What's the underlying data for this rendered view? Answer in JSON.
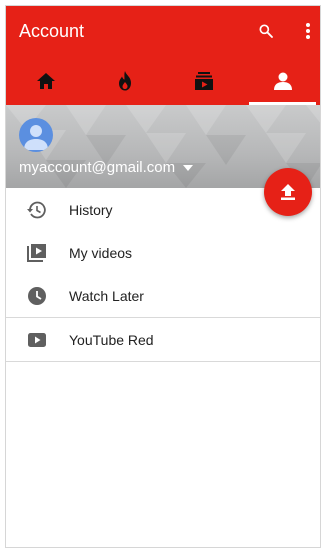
{
  "appbar": {
    "title": "Account",
    "actions": [
      {
        "icon": "search-icon"
      },
      {
        "icon": "more-vert-icon"
      }
    ]
  },
  "tabs": [
    {
      "icon": "home-icon",
      "active": false
    },
    {
      "icon": "trending-icon",
      "active": false
    },
    {
      "icon": "subscriptions-icon",
      "active": false
    },
    {
      "icon": "account-icon",
      "active": true
    }
  ],
  "account": {
    "email": "myaccount@gmail.com",
    "avatar": "avatar-icon"
  },
  "fab": {
    "icon": "upload-icon"
  },
  "menu": {
    "group1": [
      {
        "label": "History",
        "icon": "history-icon"
      },
      {
        "label": "My videos",
        "icon": "my-videos-icon"
      },
      {
        "label": "Watch Later",
        "icon": "watch-later-icon"
      }
    ],
    "group2": [
      {
        "label": "YouTube Red",
        "icon": "youtube-red-icon"
      }
    ]
  },
  "colors": {
    "brand": "#e62117",
    "icon_gray": "#5f5f5f"
  }
}
